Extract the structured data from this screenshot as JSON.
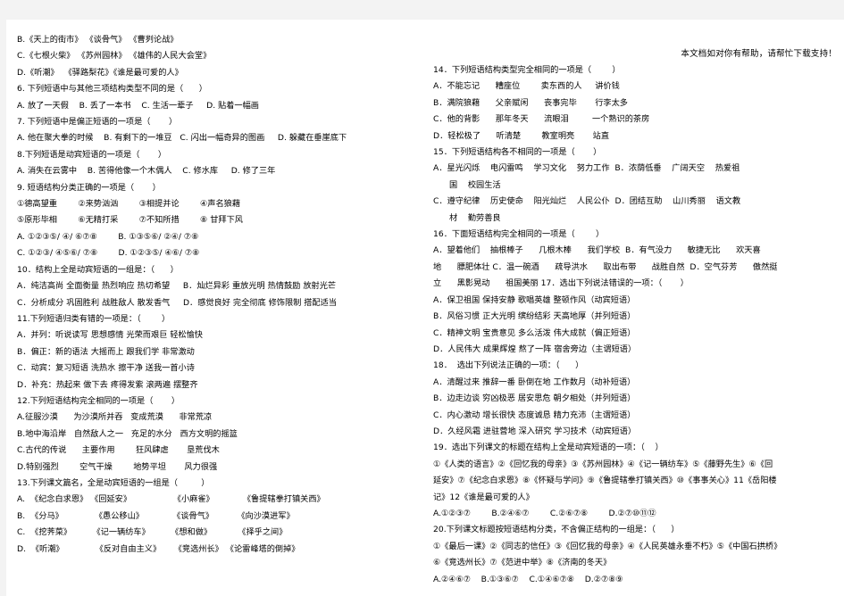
{
  "header": {
    "note": "本文档如对你有帮助，请帮忙下载支持！"
  },
  "left_column": {
    "lines": [
      "B.《天上的街市》 《谈骨气》 《曹刿论战》",
      "C.《七根火柴》 《苏州园林》 《雄伟的人民大会堂》",
      "D.《听潮》  《驿路梨花》《谁是最可爱的人》",
      "6. 下列短语中与其他三项结构类型不同的是（      ）",
      "A. 放了一天假    B. 丢了一本书    C. 生活一辈子     D. 贴着一幅画",
      "7. 下列短语中是偏正短语的一项是（       ）",
      "A. 他在聚大拳的时候    B. 有剩下的一堆豆   C. 闪出一幅奇异的图画     D. 躲藏在垂崖底下",
      "8.下列短语是动宾短语的一项是（       ）",
      "A. 消失在云雾中    B. 苦得他像一个木偶人    C. 修水库     D. 修了三年",
      "9. 短语结构分类正确的一项是（       ）",
      "①德高望重        ②来势汹汹        ③相提并论        ④声名狼藉",
      "⑤原形毕相        ⑥无精打采        ⑦不知所措        ⑧ 甘拜下风",
      "A. ①②③⑤/ ④/ ⑥⑦⑧        B. ①③⑤⑥/ ②④/ ⑦⑧",
      "C. ①②③/ ④⑤⑥/ ⑦⑧        D. ①②③⑤/ ④⑥/ ⑦⑧",
      "10．结构上全是动宾短语的一组是：（      ）",
      "A．纯洁高尚 全面衡量 热烈响应 热切希望     B．灿烂异彩 重放光明 热情鼓励 放射光芒",
      "C．分析成分 巩固胜利 战胜敌人 散发香气     D．感觉良好 完全彻底 修饰限制 搭配适当",
      "11.下列短语归类有错的一项是：（        ）",
      "A．并列：听说读写 思想感情 光荣而艰巨 轻松愉快",
      "B．偏正：新的语法 大摇而上 跟我们学 非常激动",
      "C．动宾：复习短语 洗热水 擦干净 送我一首小诗",
      "D．补充：热起来 做下去 疼得发紫 滚两遍 摆整齐",
      "12.下列短语结构完全相同的一项是（       ）",
      "A.征服沙漠      为沙漠所并吞   变成荒漠      非常荒凉",
      "B.地中海沿岸   自然敌人之一   充足的水分   西方文明的摇篮",
      "C.古代的传说      主要作用        狂风肆虐       垦荒伐木",
      "D.特别强烈        空气干燥        地势平坦       风力很强",
      "13.下列课文篇名，全是动宾短语的一组是（         ）",
      "A.  《纪念白求恩》 《回延安》                《小麻雀》           《鲁提辖拳打镇关西》",
      "B.  《分马》            《愚公移山》           《谈骨气》         《向沙漠进军》",
      "C.  《挖荠菜》        《记一辆纺车》        《想和做》          《择乎之间》",
      "D.  《听潮》            《反对自由主义》     《竞选州长》 《论雷峰塔的倒掉》"
    ]
  },
  "right_column": {
    "lines": [
      "14．下列短语结构类型完全相同的一项是（        ）",
      "A．不能忘记      糟座位        卖东西的人     讲价钱",
      "B．满院狼藉      父亲赋闲      丧事完毕       行李太多",
      "C．他的背影      那年冬天      流眼泪         一个熟识的茶房",
      "D．轻松极了      听清楚        教室明亮       站直",
      "15．下列短语结构各不相同的一项是（       ）",
      "A．星光闪烁    电闪雷鸣    学习文化    努力工作  B．浓荫低垂    广阔天空    热爱祖",
      "国    校园生活",
      "C．遵守纪律    历史使命    阳光灿烂    人民公仆  D．团结互助    山川秀丽    语文教",
      "材    勤劳善良",
      "16．下面短语结构完全相同的一项是（        ）",
      "A．望着他们    抽根棒子      几根木棒      我们学校  B．有气没力      敏捷无比      欢天喜",
      "地      膘肥体壮 C．温一碗酒      疏导洪水      取出布带      战胜自然  D．空气芬芳      傲然挺",
      "立      黑影晃动      祖国美丽 17．选出下列说法错误的一项：（       ）",
      "A．保卫祖国 保持安静 歌唱英雄 整顿作风（动宾短语）",
      "B．风俗习惯 正大光明 缤纷结彩 天高地厚（并列短语）",
      "C．精神文明 宝贵意见 多么活泼 伟大成就（偏正短语）",
      "D．人民伟大 成果辉煌 熬了一阵 宿舍旁边（主谓短语）",
      "18．  选出下列说法正确的一项：（      ）",
      "A．清醒过来 推辞一番 卧倒在地 工作数月（动补短语）",
      "B．边走边谈 穷凶极恶 居安思危 朝夕相处（并列短语）",
      "C．内心激动 增长很快 态度诚恳 精力充沛（主谓短语）",
      "D．久经风霜 进驻营地 深入研究 学习技术（动宾短语）",
      "19．选出下列课文的标题在结构上全是动宾短语的一项：（    ）",
      "①《人类的语言》②《回忆我的母亲》③《苏州园林》④《记一辆纺车》⑤《藤野先生》⑥《回",
      "延安》⑦《纪念白求恩》⑧《怀疑与学问》⑨《鲁提辖拳打镇关西》⑩《事事关心》11《岳阳楼",
      "记》12《谁是最可爱的人》",
      "A.①②③⑦        B.②④⑥⑦        C.②⑥⑦⑧        D.②⑦⑩⑪⑫",
      "20.下列课文标题按短语结构分类，不含偏正结构的一组是：（      ）",
      "①《最后一课》②《同志的信任》③《回忆我的母亲》④《人民英雄永垂不朽》⑤《中国石拱桥》",
      "⑥《竞选州长》⑦《范进中举》⑧《济南的冬天》",
      "A.②④⑥⑦    B.①③⑥⑦    C.①④⑥⑦⑧    D.②⑦⑧⑨"
    ]
  }
}
